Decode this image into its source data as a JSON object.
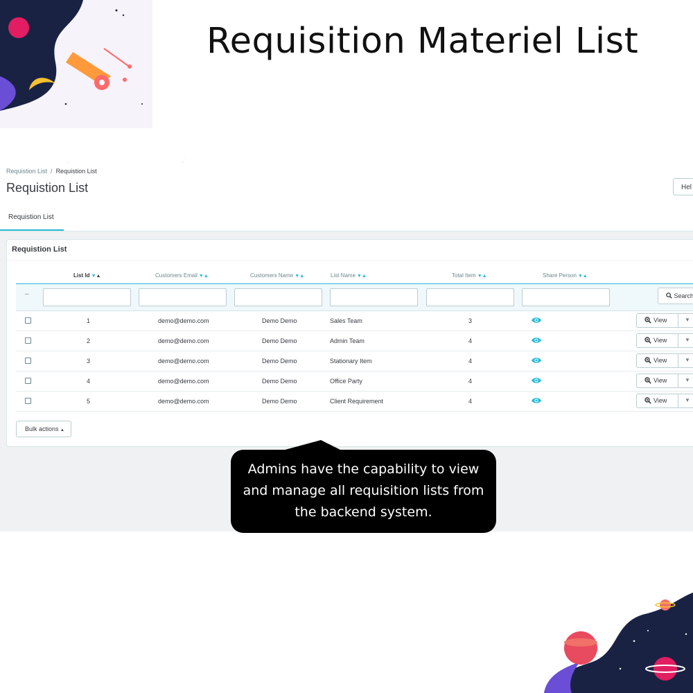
{
  "headline": "Requisition Materiel List",
  "breadcrumb": {
    "parent": "Requistion List",
    "separator": "/",
    "current": "Requistion List"
  },
  "page_title": "Requistion List",
  "help_button_label": "Hel",
  "tab_label": "Requistion List",
  "panel_title": "Requistion List",
  "table": {
    "columns": [
      "List Id",
      "Customers Email",
      "Customers Name",
      "List Name",
      "Total Item",
      "Share Person"
    ],
    "filter_dash": "–",
    "search_label": "Search",
    "rows": [
      {
        "id": "1",
        "email": "demo@demo.com",
        "name": "Demo Demo",
        "list_name": "Sales Team",
        "total": "3"
      },
      {
        "id": "2",
        "email": "demo@demo.com",
        "name": "Demo Demo",
        "list_name": "Admin Team",
        "total": "4"
      },
      {
        "id": "3",
        "email": "demo@demo.com",
        "name": "Demo Demo",
        "list_name": "Stationary Item",
        "total": "4"
      },
      {
        "id": "4",
        "email": "demo@demo.com",
        "name": "Demo Demo",
        "list_name": "Office Party",
        "total": "4"
      },
      {
        "id": "5",
        "email": "demo@demo.com",
        "name": "Demo Demo",
        "list_name": "Client Requirement",
        "total": "4"
      }
    ],
    "view_label": "View"
  },
  "bulk_actions_label": "Bulk actions",
  "callout_lines": [
    "Admins have the capability to view",
    "and manage all requisition lists from",
    "the backend system."
  ],
  "colors": {
    "accent": "#25b9d7",
    "callout_bg": "#000000",
    "page_bg": "#eff1f2"
  },
  "icons": [
    "magnifier-icon",
    "eye-icon",
    "caret-down-icon",
    "sort-arrows-icon"
  ]
}
